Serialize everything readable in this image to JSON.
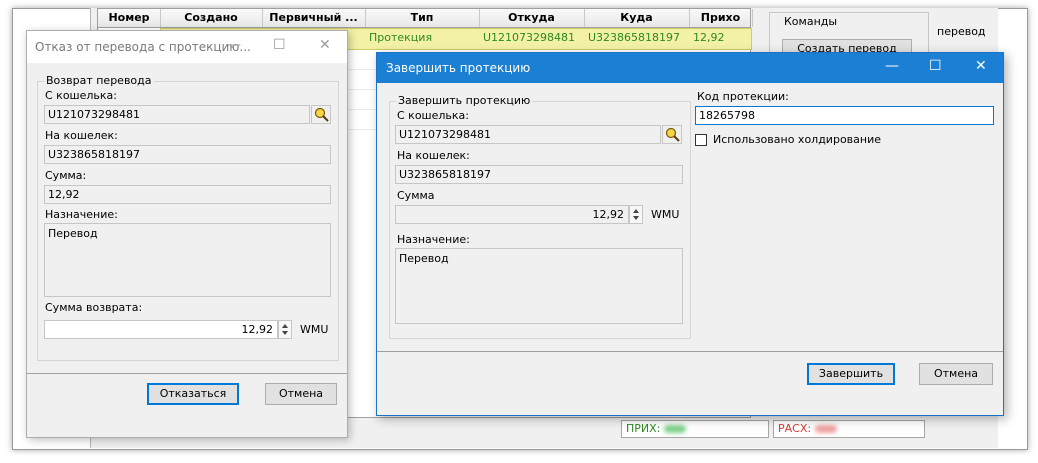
{
  "bg_grid": {
    "headers": [
      "Номер",
      "Создано",
      "Первичный ...",
      "Тип",
      "Откуда",
      "Куда",
      "Прихо"
    ],
    "row": {
      "type": "Протекция",
      "from": "U121073298481",
      "to": "U323865818197",
      "amount": "12,92"
    }
  },
  "commands": {
    "title": "Команды",
    "create_transfer": "Создать перевод",
    "side_label": "перевод"
  },
  "status": {
    "income_label": "ПРИХ:",
    "expense_label": "РАСХ:"
  },
  "refuse_dialog": {
    "title": "Отказ от перевода с протекцию...",
    "group": "Возврат перевода",
    "from_label": "С кошелька:",
    "from_value": "U121073298481",
    "to_label": "На кошелек:",
    "to_value": "U323865818197",
    "amount_label": "Сумма:",
    "amount_value": "12,92",
    "purpose_label": "Назначение:",
    "purpose_value": "Перевод",
    "refund_label": "Сумма возврата:",
    "refund_value": "12,92",
    "currency": "WMU",
    "refuse_button": "Отказаться",
    "cancel_button": "Отмена"
  },
  "finish_dialog": {
    "title": "Завершить протекцию",
    "group": "Завершить протекцию",
    "from_label": "С кошелька:",
    "from_value": "U121073298481",
    "to_label": "На кошелек:",
    "to_value": "U323865818197",
    "amount_label": "Сумма",
    "amount_value": "12,92",
    "currency": "WMU",
    "purpose_label": "Назначение:",
    "purpose_value": "Перевод",
    "code_label": "Код протекции:",
    "code_value": "18265798",
    "holding_label": "Использовано холдирование",
    "holding_checked": false,
    "finish_button": "Завершить",
    "cancel_button": "Отмена"
  },
  "colors": {
    "accent": "#0078d7",
    "title_bar": "#1b80d3",
    "row_highlight": "#f3f1a6",
    "row_text": "#2c8a1e",
    "income": "#2c8a1e",
    "expense": "#d83b3b"
  }
}
